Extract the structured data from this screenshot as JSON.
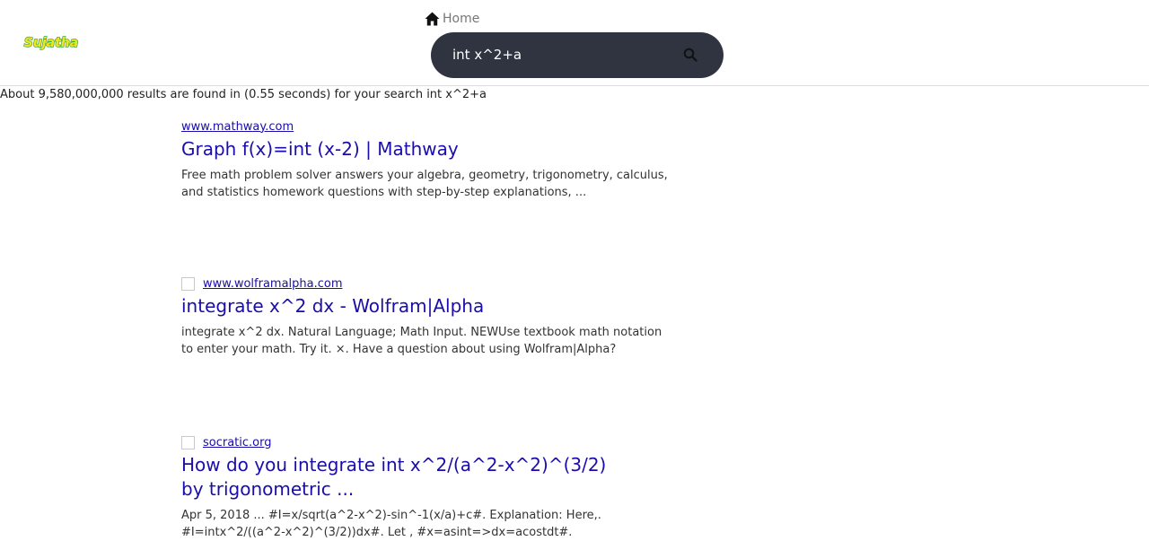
{
  "header": {
    "logo_text": "Sujatha",
    "home_label": "Home",
    "search": {
      "value": "int x^2+a",
      "icon": "search-icon"
    }
  },
  "stats": {
    "text": "About 9,580,000,000 results are found in (0.55 seconds) for your search int x^2+a"
  },
  "results": [
    {
      "url": "www.mathway.com",
      "title": "Graph f(x)=int (x-2) | Mathway",
      "snippet": "Free math problem solver answers your algebra, geometry, trigonometry, calculus, and statistics homework questions with step-by-step explanations, ..."
    },
    {
      "url": "www.wolframalpha.com",
      "title": "integrate x^2 dx - Wolfram|Alpha",
      "snippet": "integrate x^2 dx. Natural Language; Math Input. NEWUse textbook math notation to enter your math. Try it. ×. Have a question about using Wolfram|Alpha?"
    },
    {
      "url": "socratic.org",
      "title": "How do you integrate int x^2/(a^2-x^2)^(3/2) by trigonometric ...",
      "snippet": "Apr 5, 2018 ... #I=x/sqrt(a^2-x^2)-sin^-1(x/a)+c#. Explanation: Here,. #I=intx^2/((a^2-x^2)^(3/2))dx#. Let , #x=asint=>dx=acostdt#."
    }
  ],
  "colors": {
    "link": "#1a0dab",
    "search_bar": "#2f3440",
    "logo_fill": "#f4e61e",
    "logo_stroke": "#3aa935"
  }
}
